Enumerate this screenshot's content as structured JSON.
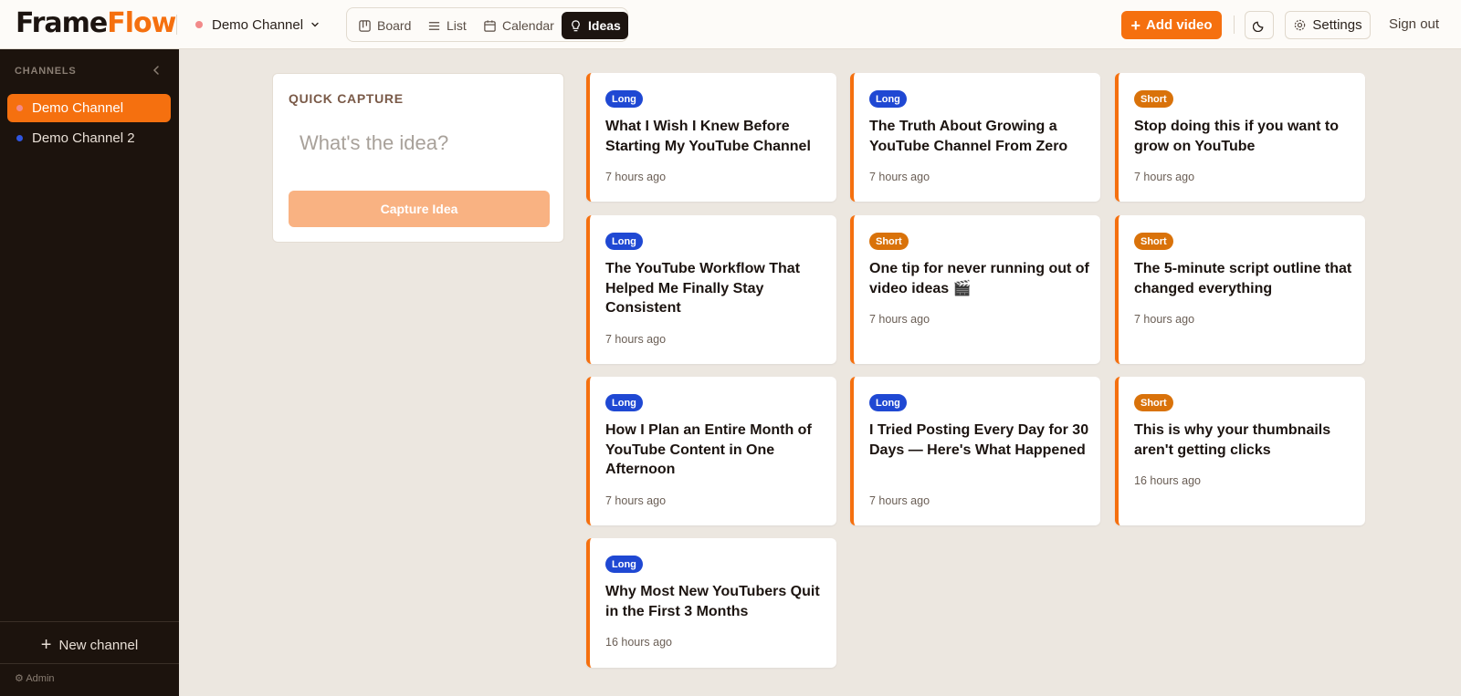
{
  "app": {
    "logo_part1": "Frame",
    "logo_part2": "Flow"
  },
  "header": {
    "channel": "Demo Channel",
    "tabs": [
      {
        "label": "Board",
        "icon": "board-icon"
      },
      {
        "label": "List",
        "icon": "list-icon"
      },
      {
        "label": "Calendar",
        "icon": "calendar-icon"
      },
      {
        "label": "Ideas",
        "icon": "lightbulb-icon",
        "active": true
      }
    ],
    "add_video": "Add video",
    "settings": "Settings",
    "sign_out": "Sign out"
  },
  "sidebar": {
    "heading": "CHANNELS",
    "channels": [
      {
        "label": "Demo Channel",
        "color": "#f28a8a",
        "active": true
      },
      {
        "label": "Demo Channel 2",
        "color": "#2f55e0"
      }
    ],
    "new_channel": "New channel",
    "admin": "Admin"
  },
  "capture": {
    "title": "QUICK CAPTURE",
    "placeholder": "What's the idea?",
    "button": "Capture Idea"
  },
  "colors": {
    "accent": "#f5700f",
    "long_badge": "#1f48d3",
    "short_badge": "#d9720a"
  },
  "ideas": [
    {
      "type": "Long",
      "title": "What I Wish I Knew Before Starting My YouTube Channel",
      "time": "7 hours ago"
    },
    {
      "type": "Long",
      "title": "The Truth About Growing a YouTube Channel From Zero",
      "time": "7 hours ago"
    },
    {
      "type": "Short",
      "title": "Stop doing this if you want to grow on YouTube",
      "time": "7 hours ago"
    },
    {
      "type": "Long",
      "title": "The YouTube Workflow That Helped Me Finally Stay Consistent",
      "time": "7 hours ago"
    },
    {
      "type": "Short",
      "title": "One tip for never running out of video ideas 🎬",
      "time": "7 hours ago"
    },
    {
      "type": "Short",
      "title": "The 5-minute script outline that changed everything",
      "time": "7 hours ago"
    },
    {
      "type": "Long",
      "title": "How I Plan an Entire Month of YouTube Content in One Afternoon",
      "time": "7 hours ago"
    },
    {
      "type": "Long",
      "title": "I Tried Posting Every Day for 30 Days — Here's What Happened",
      "time": "7 hours ago"
    },
    {
      "type": "Short",
      "title": "This is why your thumbnails aren't getting clicks",
      "time": "16 hours ago"
    },
    {
      "type": "Long",
      "title": "Why Most New YouTubers Quit in the First 3 Months",
      "time": "16 hours ago"
    }
  ]
}
